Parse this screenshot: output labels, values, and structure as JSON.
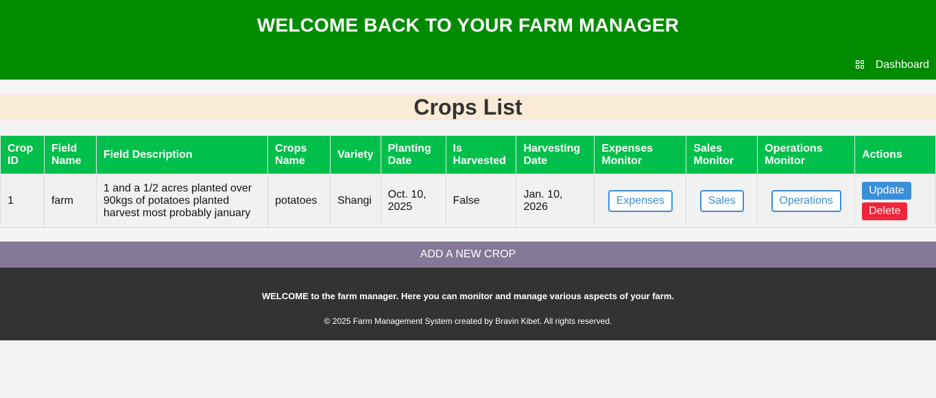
{
  "header": {
    "title": "WELCOME BACK TO YOUR FARM MANAGER",
    "nav_label": "Dashboard",
    "nav_icon": "grid-icon"
  },
  "section_title": "Crops List",
  "table": {
    "headers": {
      "crop_id": "Crop ID",
      "field_name": "Field Name",
      "field_description": "Field Description",
      "crops_name": "Crops Name",
      "variety": "Variety",
      "planting_date": "Planting Date",
      "is_harvested": "Is Harvested",
      "harvesting_date": "Harvesting Date",
      "expenses_monitor": "Expenses Monitor",
      "sales_monitor": "Sales Monitor",
      "operations_monitor": "Operations Monitor",
      "actions": "Actions"
    },
    "rows": [
      {
        "crop_id": "1",
        "field_name": "farm",
        "field_description": "1 and a 1/2 acres planted over 90kgs of potatoes planted harvest most probably january",
        "crops_name": "potatoes",
        "variety": "Shangi",
        "planting_date": "Oct. 10, 2025",
        "is_harvested": "False",
        "harvesting_date": "Jan. 10, 2026",
        "expenses_btn": "Expenses",
        "sales_btn": "Sales",
        "operations_btn": "Operations",
        "update_btn": "Update",
        "delete_btn": "Delete"
      }
    ]
  },
  "add_crop_label": "ADD A NEW CROP",
  "footer": {
    "welcome": "WELCOME to the farm manager. Here you can monitor and manage various aspects of your farm.",
    "copyright": "© 2025 Farm Management System created by Bravin Kibet. All rights reserved."
  },
  "colors": {
    "header_bg": "#008b00",
    "table_header_bg": "#00c04b",
    "title_band_bg": "#faebd7",
    "add_button_bg": "#837896",
    "footer_bg": "#333333",
    "outline_button": "#3a8fd8",
    "delete_button": "#f0243a"
  }
}
